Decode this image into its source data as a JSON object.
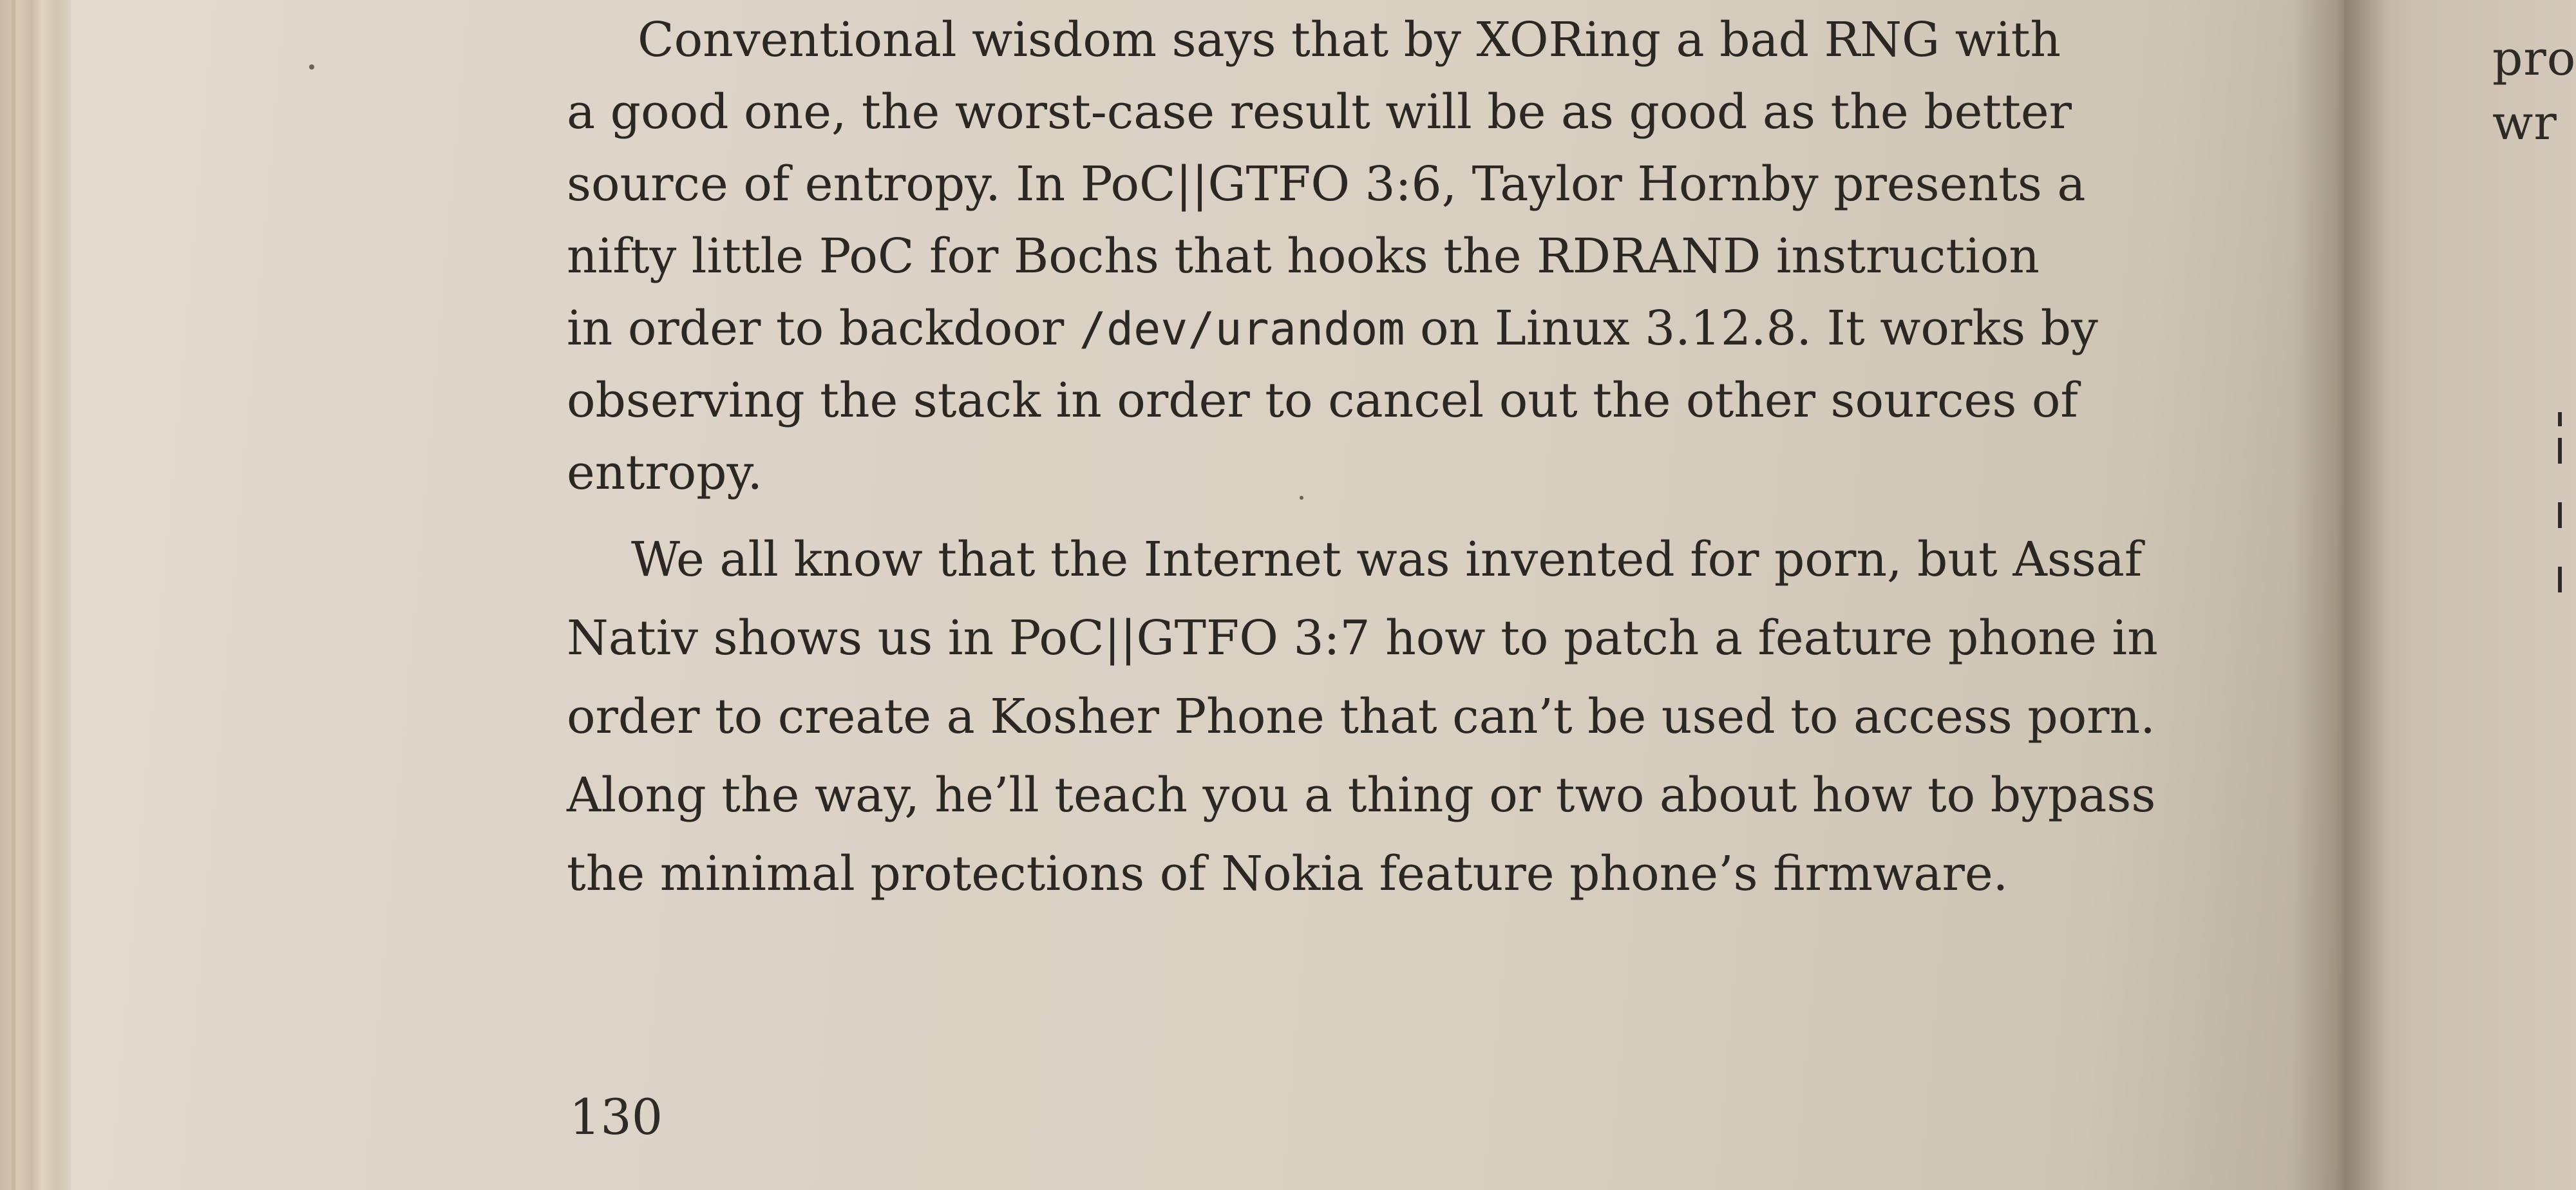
{
  "paragraphs": [
    {
      "lines": [
        "Conventional wisdom says that by XORing a bad RNG with",
        "a good one, the worst-case result will be as good as the better",
        "source of entropy. In PoC||GTFO 3:6, Taylor Hornby presents a",
        "nifty little PoC for Bochs that hooks the RDRAND instruction",
        {
          "before": "in order to backdoor ",
          "code": "/dev/urandom",
          "after": " on Linux 3.12.8. It works by"
        },
        "observing the stack in order to cancel out the other sources of",
        "entropy."
      ]
    },
    {
      "lines": [
        "We all know that the Internet was invented for porn, but Assaf",
        "Nativ shows us in PoC||GTFO 3:7 how to patch a feature phone in",
        "order to create a Kosher Phone that can’t be used to access porn.",
        "Along the way, he’ll teach you a thing or two about how to bypass",
        "the minimal protections of Nokia feature phone’s firmware."
      ]
    }
  ],
  "page_number": "130",
  "facing_page_fragments": [
    "",
    "pro",
    "wr"
  ],
  "colors": {
    "paper": "#dcd3c6",
    "ink": "#2b2723"
  }
}
